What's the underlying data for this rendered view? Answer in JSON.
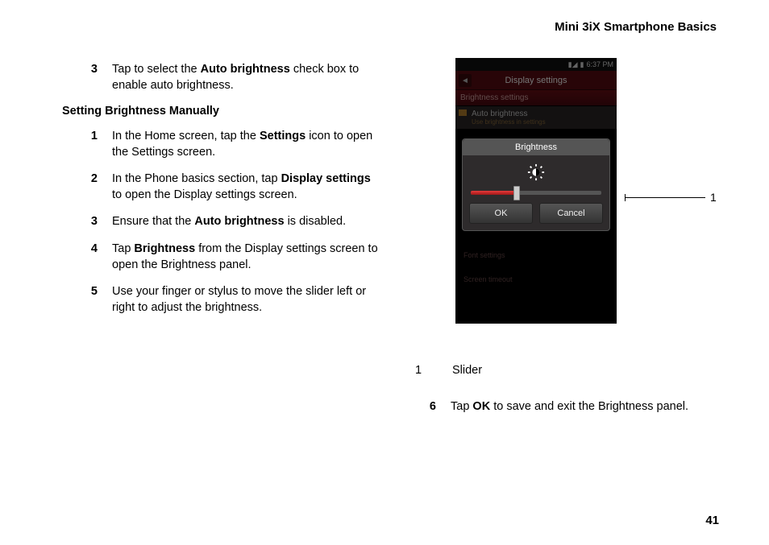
{
  "header": {
    "title": "Mini 3iX Smartphone Basics"
  },
  "page_number": "41",
  "left": {
    "pre_step": {
      "num": "3",
      "text_before": "Tap to select the ",
      "bold1": "Auto brightness",
      "text_after": " check box to enable auto brightness."
    },
    "subheading": "Setting Brightness Manually",
    "steps": [
      {
        "num": "1",
        "t1": "In the Home screen, tap the ",
        "b1": "Settings",
        "t2": " icon to open the Settings screen."
      },
      {
        "num": "2",
        "t1": "In the Phone basics section, tap ",
        "b1": "Display settings",
        "t2": " to open the Display settings screen."
      },
      {
        "num": "3",
        "t1": "Ensure that the ",
        "b1": "Auto brightness",
        "t2": " is disabled."
      },
      {
        "num": "4",
        "t1": "Tap ",
        "b1": "Brightness",
        "t2": " from the Display settings screen to open the Brightness panel."
      },
      {
        "num": "5",
        "t1": "Use your finger or stylus to move the slider left or right to adjust the brightness.",
        "b1": "",
        "t2": ""
      }
    ]
  },
  "phone": {
    "status_time": "6:37 PM",
    "title": "Display settings",
    "subbar": "Brightness settings",
    "row_auto_title": "Auto brightness",
    "row_auto_sub": "Use brightness in settings",
    "dialog_title": "Brightness",
    "ok_label": "OK",
    "cancel_label": "Cancel",
    "bg_text1": "Font settings",
    "bg_text2": "Screen timeout"
  },
  "callout": {
    "num": "1"
  },
  "legend": {
    "num": "1",
    "label": "Slider"
  },
  "step6": {
    "num": "6",
    "t1": "Tap ",
    "b1": "OK",
    "t2": " to save and exit the Brightness panel."
  }
}
